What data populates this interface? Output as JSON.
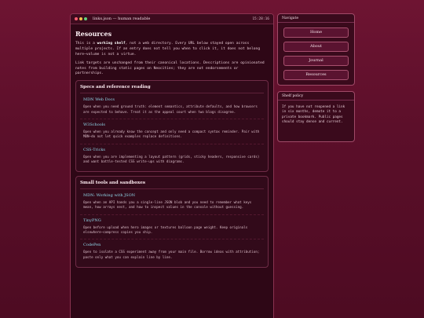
{
  "window": {
    "title": "links.json — human readable",
    "clock": "15:28:16"
  },
  "page": {
    "heading": "Resources",
    "intro_pre": "This is a ",
    "intro_bold": "working shelf",
    "intro_post": ", not a web directory. Every URL below stayed open across multiple projects. If an entry does not tell you when to click it, it does not belong here—volume is not a virtue.",
    "intro2": "Link targets are unchanged from their canonical locations. Descriptions are opinionated notes from building static pages on Neocities; they are not endorsements or partnerships."
  },
  "sections": [
    {
      "title": "Specs and reference reading",
      "entries": [
        {
          "name": "MDN Web Docs",
          "desc": "Open when you need ground truth: element semantics, attribute defaults, and how browsers are expected to behave. Treat it as the appeal court when two blogs disagree."
        },
        {
          "name": "W3Schools",
          "desc": "Open when you already know the concept and only need a compact syntax reminder. Pair with MDN—do not let quick examples replace definitions."
        },
        {
          "name": "CSS-Tricks",
          "desc": "Open when you are implementing a layout pattern (grids, sticky headers, responsive cards) and want battle-tested CSS write-ups with diagrams."
        }
      ]
    },
    {
      "title": "Small tools and sandboxes",
      "entries": [
        {
          "name": "MDN: Working with JSON",
          "desc": "Open when an API hands you a single-line JSON blob and you need to remember what keys mean, how arrays nest, and how to inspect values in the console without guessing."
        },
        {
          "name": "TinyPNG",
          "desc": "Open before upload when hero images or textures balloon page weight. Keep originals elsewhere—compress copies you ship."
        },
        {
          "name": "CodePen",
          "desc": "Open to isolate a CSS experiment away from your main file. Borrow ideas with attribution; paste only what you can explain line by line."
        }
      ]
    }
  ],
  "nav": {
    "heading": "Navigate",
    "items": [
      "Home",
      "About",
      "Journal",
      "Resources"
    ]
  },
  "policy": {
    "heading": "Shelf policy",
    "text": "If you have not reopened a link in six months, demote it to a private bookmark. Public pages should stay dense and current."
  }
}
